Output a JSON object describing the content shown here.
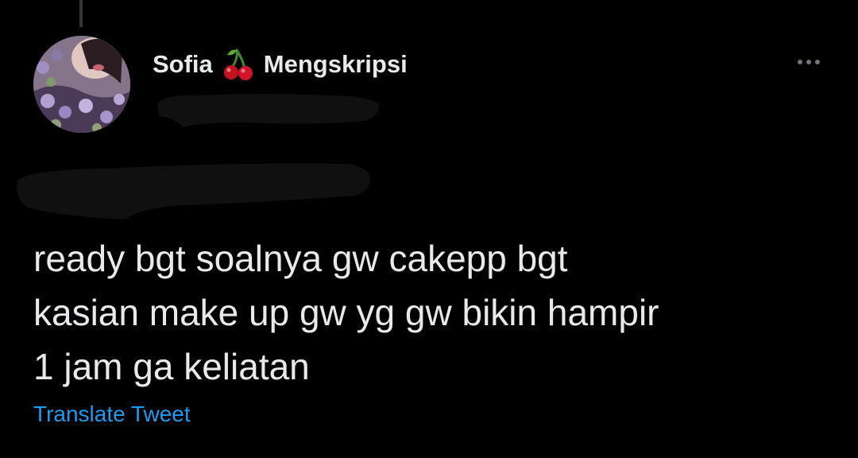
{
  "tweet": {
    "author": {
      "name_first": "Sofia",
      "name_emoji": "cherries-icon",
      "name_second": "Mengskripsi"
    },
    "text": "ready bgt soalnya gw cakepp bgt\nkasian make up gw yg gw bikin hampir\n1 jam ga keliatan",
    "translate_label": "Translate Tweet",
    "more_icon": "more-horizontal-icon"
  },
  "colors": {
    "background": "#000000",
    "text": "#e7e9ea",
    "link": "#1d9bf0",
    "muted": "#71767b"
  }
}
